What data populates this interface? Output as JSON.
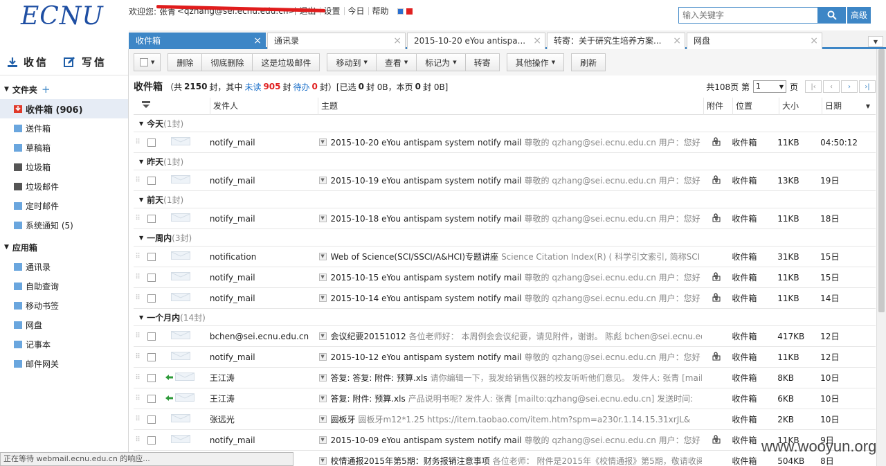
{
  "header": {
    "logo": "ECNU",
    "welcome": "欢迎您: 张青",
    "email": "<qzhang@sei.ecnu.edu.cn>",
    "links": [
      "退出",
      "设置",
      "今日",
      "帮助"
    ],
    "square_colors": [
      "#2a6fd0",
      "#e02020"
    ]
  },
  "search": {
    "placeholder": "输入关键字",
    "advanced": "高级"
  },
  "tabs": [
    {
      "label": "收件箱"
    },
    {
      "label": "通讯录"
    },
    {
      "label": "2015-10-20 eYou antispa..."
    },
    {
      "label": "转寄：关于研究生培养方案..."
    },
    {
      "label": "网盘"
    }
  ],
  "sidebar": {
    "receive": "收信",
    "write": "写信",
    "folders_title": "文件夹",
    "folders": [
      {
        "label": "收件箱 (906)",
        "color": "#e03a2a"
      },
      {
        "label": "送件箱",
        "color": "#6aa6de"
      },
      {
        "label": "草稿箱",
        "color": "#6aa6de"
      },
      {
        "label": "垃圾箱",
        "color": "#555555"
      },
      {
        "label": "垃圾邮件",
        "color": "#555555"
      },
      {
        "label": "定时邮件",
        "color": "#6aa6de"
      },
      {
        "label": "系统通知 (5)",
        "color": "#6aa6de"
      }
    ],
    "apps_title": "应用箱",
    "apps": [
      {
        "label": "通讯录"
      },
      {
        "label": "自助查询"
      },
      {
        "label": "移动书签"
      },
      {
        "label": "网盘"
      },
      {
        "label": "记事本"
      },
      {
        "label": "邮件网关"
      }
    ]
  },
  "toolbar": {
    "delete": "删除",
    "purge": "彻底删除",
    "spam": "这是垃圾邮件",
    "move": "移动到",
    "view": "查看",
    "mark": "标记为",
    "forward": "转寄",
    "more": "其他操作",
    "refresh": "刷新"
  },
  "summary": {
    "folder": "收件箱",
    "p1": "（共",
    "total": "2150",
    "p2": "封，其中",
    "unread_label": "未读",
    "unread": "905",
    "p3": "封",
    "todo_label": "待办",
    "todo": "0",
    "p4": "封）[已选",
    "sel": "0",
    "p5": "封 0B，本页",
    "page_count": "0",
    "p6": "封 0B]",
    "pages_label": "共108页 第",
    "page": "1",
    "page_suffix": "页"
  },
  "columns": {
    "from": "发件人",
    "subject": "主题",
    "attach": "附件",
    "location": "位置",
    "size": "大小",
    "date": "日期"
  },
  "groups": [
    {
      "label": "今天",
      "count": "(1封)",
      "rows": [
        {
          "from": "notify_mail",
          "subject": "2015-10-20 eYou antispam system notify mail",
          "preview": "尊敬的 qzhang@sei.ecnu.edu.cn 用户：您好",
          "att": true,
          "loc": "收件箱",
          "size": "11KB",
          "date": "04:50:12",
          "reply": false
        }
      ]
    },
    {
      "label": "昨天",
      "count": "(1封)",
      "rows": [
        {
          "from": "notify_mail",
          "subject": "2015-10-19 eYou antispam system notify mail",
          "preview": "尊敬的 qzhang@sei.ecnu.edu.cn 用户：您好",
          "att": true,
          "loc": "收件箱",
          "size": "13KB",
          "date": "19日",
          "reply": false
        }
      ]
    },
    {
      "label": "前天",
      "count": "(1封)",
      "rows": [
        {
          "from": "notify_mail",
          "subject": "2015-10-18 eYou antispam system notify mail",
          "preview": "尊敬的 qzhang@sei.ecnu.edu.cn 用户：您好",
          "att": true,
          "loc": "收件箱",
          "size": "11KB",
          "date": "18日",
          "reply": false
        }
      ]
    },
    {
      "label": "一周内",
      "count": "(3封)",
      "rows": [
        {
          "from": "notification",
          "subject": "Web of Science(SCI/SSCI/A&HCI)专题讲座",
          "preview": "Science Citation Index(R) ( 科学引文索引, 简称SCI",
          "att": false,
          "loc": "收件箱",
          "size": "31KB",
          "date": "15日",
          "reply": false
        },
        {
          "from": "notify_mail",
          "subject": "2015-10-15 eYou antispam system notify mail",
          "preview": "尊敬的 qzhang@sei.ecnu.edu.cn 用户：您好",
          "att": true,
          "loc": "收件箱",
          "size": "11KB",
          "date": "15日",
          "reply": false
        },
        {
          "from": "notify_mail",
          "subject": "2015-10-14 eYou antispam system notify mail",
          "preview": "尊敬的 qzhang@sei.ecnu.edu.cn 用户：您好",
          "att": true,
          "loc": "收件箱",
          "size": "11KB",
          "date": "14日",
          "reply": false
        }
      ]
    },
    {
      "label": "一个月内",
      "count": "(14封)",
      "rows": [
        {
          "from": "bchen@sei.ecnu.edu.cn",
          "subject": "会议纪要20151012",
          "preview": "各位老师好： 本周例会会议纪要，请见附件，谢谢。 陈彪 bchen@sei.ecnu.edu.cn",
          "att": false,
          "loc": "收件箱",
          "size": "417KB",
          "date": "12日",
          "reply": false
        },
        {
          "from": "notify_mail",
          "subject": "2015-10-12 eYou antispam system notify mail",
          "preview": "尊敬的 qzhang@sei.ecnu.edu.cn 用户：您好",
          "att": true,
          "loc": "收件箱",
          "size": "11KB",
          "date": "12日",
          "reply": false
        },
        {
          "from": "王江涛",
          "subject": "答复: 答复: 附件: 预算.xls",
          "preview": "请你编辑一下，我发给销售仪器的校友听听他们意见。 发件人: 张青 [mailto",
          "att": false,
          "loc": "收件箱",
          "size": "8KB",
          "date": "10日",
          "reply": true
        },
        {
          "from": "王江涛",
          "subject": "答复: 附件: 预算.xls",
          "preview": "产品说明书呢? 发件人: 张青 [mailto:qzhang@sei.ecnu.edu.cn] 发送时间:",
          "att": false,
          "loc": "收件箱",
          "size": "6KB",
          "date": "10日",
          "reply": true
        },
        {
          "from": "张远光",
          "subject": "圆板牙",
          "preview": "圆板牙m12*1.25 https://item.taobao.com/item.htm?spm=a230r.1.14.15.31xrJL&",
          "att": false,
          "loc": "收件箱",
          "size": "2KB",
          "date": "10日",
          "reply": false
        },
        {
          "from": "notify_mail",
          "subject": "2015-10-09 eYou antispam system notify mail",
          "preview": "尊敬的 qzhang@sei.ecnu.edu.cn 用户：您好",
          "att": true,
          "loc": "收件箱",
          "size": "11KB",
          "date": "9日",
          "reply": false
        },
        {
          "from": "",
          "subject": "校情通报2015年第5期：财务报销注意事项",
          "preview": "各位老师： 附件是2015年《校情通报》第5期，敬请收阅",
          "att": false,
          "loc": "收件箱",
          "size": "504KB",
          "date": "8日",
          "reply": false
        }
      ]
    }
  ],
  "status": "正在等待 webmail.ecnu.edu.cn 的响应...",
  "watermark": "www.wooyun.org"
}
